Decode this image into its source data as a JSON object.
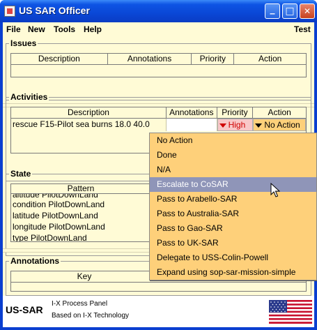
{
  "window": {
    "title": "US SAR Officer",
    "controls": {
      "minimize": "_",
      "maximize": "□",
      "close": "✕"
    }
  },
  "menubar": {
    "file": "File",
    "new": "New",
    "tools": "Tools",
    "help": "Help",
    "test": "Test"
  },
  "issues": {
    "title": "Issues",
    "columns": [
      "Description",
      "Annotations",
      "Priority",
      "Action"
    ]
  },
  "activities": {
    "title": "Activities",
    "columns": [
      "Description",
      "Annotations",
      "Priority",
      "Action"
    ],
    "rows": [
      {
        "description": "rescue F15-Pilot sea burns 18.0 40.0",
        "annotations": "",
        "priority": "High",
        "action": "No Action"
      }
    ]
  },
  "state": {
    "title": "State",
    "columns": [
      "Pattern"
    ],
    "partial_row": "altitude PilotDownLand",
    "rows": [
      "condition PilotDownLand",
      "latitude PilotDownLand",
      "longitude PilotDownLand",
      "type PilotDownLand"
    ]
  },
  "annotations": {
    "title": "Annotations",
    "columns": [
      "Key"
    ]
  },
  "footer": {
    "logo": "US-SAR",
    "line1": "I-X Process Panel",
    "line2": "Based on I-X Technology"
  },
  "dropdown": {
    "items": [
      "No Action",
      "Done",
      "N/A",
      "Escalate to CoSAR",
      "Pass to Arabello-SAR",
      "Pass to Australia-SAR",
      "Pass to Gao-SAR",
      "Pass to UK-SAR",
      "Delegate to USS-Colin-Powell",
      "Expand using sop-sar-mission-simple"
    ],
    "highlighted": "Escalate to CoSAR"
  },
  "colors": {
    "panel_bg": "#fffbd6",
    "dropdown_bg": "#fed07a",
    "highlight": "#8f95b8",
    "priority_bg": "#f8c8c8",
    "action_bg": "#fed07a",
    "titlebar": "#0a47d6"
  }
}
